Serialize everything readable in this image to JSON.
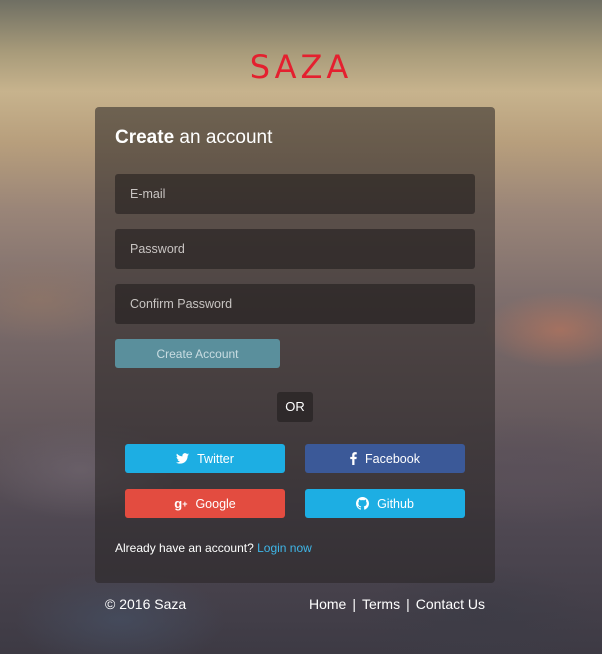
{
  "brand": {
    "logo_text": "SAZA",
    "logo_color": "#e4202f"
  },
  "form": {
    "title_bold": "Create",
    "title_rest": " an account",
    "email_placeholder": "E-mail",
    "password_placeholder": "Password",
    "confirm_placeholder": "Confirm Password",
    "submit_label": "Create Account",
    "or_label": "OR"
  },
  "social": {
    "twitter": {
      "label": "Twitter",
      "icon": "twitter-bird-icon",
      "color": "#1daee3"
    },
    "facebook": {
      "label": "Facebook",
      "icon": "facebook-f-icon",
      "color": "#3b5998"
    },
    "google": {
      "label": "Google",
      "icon": "google-plus-icon",
      "color": "#e34c40"
    },
    "github": {
      "label": "Github",
      "icon": "github-octocat-icon",
      "color": "#1daee3"
    }
  },
  "login_prompt": {
    "text": "Already have an account? ",
    "link": "Login now"
  },
  "footer": {
    "copyright": "© 2016 Saza",
    "links": [
      "Home",
      "Terms",
      "Contact Us"
    ],
    "separator": "|"
  }
}
